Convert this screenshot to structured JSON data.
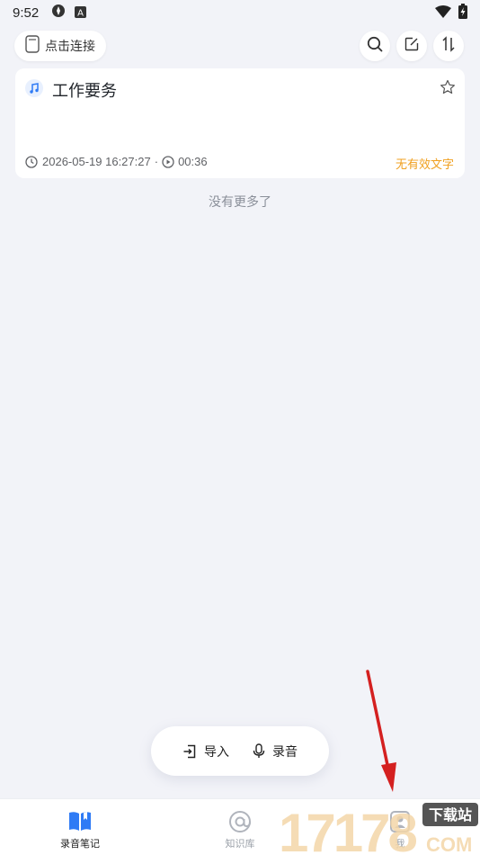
{
  "status_bar": {
    "time": "9:52",
    "left_icons": [
      "compass-icon",
      "a-badge-icon"
    ],
    "right_icons": [
      "wifi-icon",
      "battery-icon"
    ]
  },
  "top_bar": {
    "connect_label": "点击连接",
    "buttons": [
      "search-icon",
      "edit-icon",
      "sort-icon"
    ]
  },
  "recordings": [
    {
      "title": "工作要务",
      "datetime": "2026-05-19 16:27:27",
      "separator": "·",
      "duration": "00:36",
      "status": "无有效文字",
      "starred": false
    }
  ],
  "list_end_text": "没有更多了",
  "actions": {
    "import_label": "导入",
    "record_label": "录音"
  },
  "tabs": [
    {
      "label": "录音笔记",
      "active": true
    },
    {
      "label": "知识库",
      "active": false
    },
    {
      "label": "我",
      "active": false
    }
  ],
  "watermark": {
    "text_top": "下载站",
    "text_bottom": "17178",
    "text_com": "COM"
  },
  "colors": {
    "background": "#f2f3f8",
    "accent": "#2f7bf5",
    "status_warning": "#f0a020",
    "annotation_arrow": "#d42020"
  }
}
